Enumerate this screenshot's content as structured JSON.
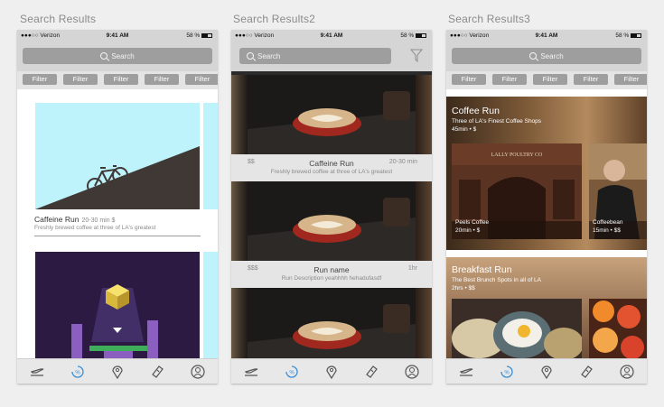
{
  "boards": [
    {
      "title": "Search Results"
    },
    {
      "title": "Search Results2"
    },
    {
      "title": "Search Results3"
    }
  ],
  "status_bar": {
    "carrier": "●●●○○ Verizon",
    "time": "9:41 AM",
    "battery": "58 %"
  },
  "search": {
    "placeholder": "Search"
  },
  "filters": [
    "Filter",
    "Filter",
    "Filter",
    "Filter",
    "Filter"
  ],
  "screen1": {
    "card": {
      "title": "Caffeine Run",
      "meta": "20-30 min  $",
      "description": "Freshly brewed coffee at three of LA's greatest"
    }
  },
  "screen2": {
    "items": [
      {
        "price": "$$",
        "name": "Caffeine Run",
        "duration": "20-30 min",
        "description": "Freshly brewed coffee at three of LA's greatest"
      },
      {
        "price": "$$$",
        "name": "Run name",
        "duration": "1hr",
        "description": "Run Description yeahhhh hehadufasdf"
      }
    ]
  },
  "screen3": {
    "sections": [
      {
        "title": "Coffee Run",
        "subtitle": "Three of LA's Finest Coffee Shops",
        "meta": "45min • $",
        "places": [
          {
            "name": "Peels Coffee",
            "meta": "20min • $",
            "sign": "LALLY POULTRY CO"
          },
          {
            "name": "Coffeebean",
            "meta": "15min • $$"
          }
        ]
      },
      {
        "title": "Breakfast Run",
        "subtitle": "The Best Brunch Spots in all of LA",
        "meta": "2hrs • $$"
      }
    ]
  },
  "tabbar": {
    "icons": [
      "airplane-icon",
      "discount-icon",
      "map-pin-icon",
      "ticket-icon",
      "profile-icon"
    ],
    "active_color": "#3a8fd6"
  }
}
